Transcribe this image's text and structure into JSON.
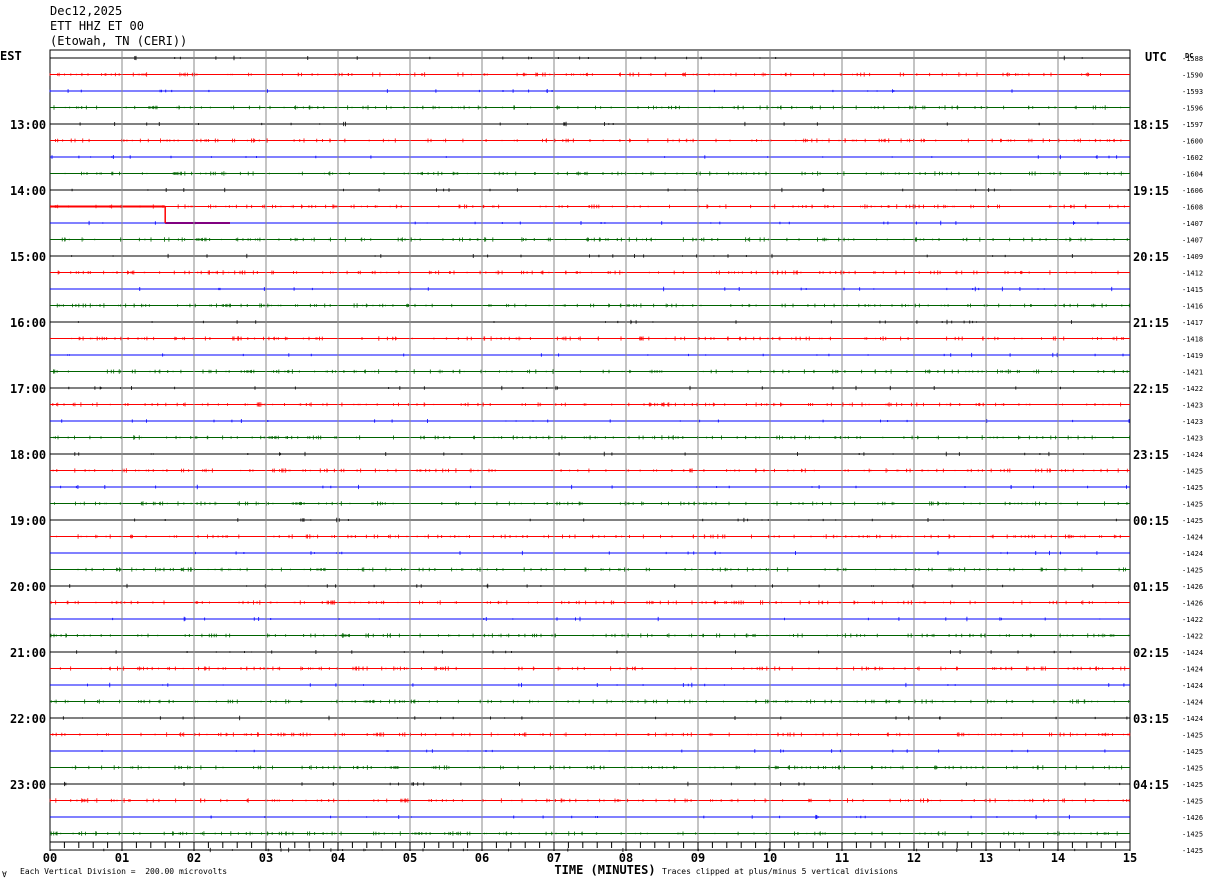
{
  "header": {
    "date": "Dec12,2025",
    "station": "ETT HHZ ET 00",
    "location": "(Etowah, TN (CERI))"
  },
  "footer": {
    "mark": "∀",
    "scale": "Each Vertical Division =  200.00 microvolts",
    "clip": "Traces clipped at plus/minus 5 vertical divisions"
  },
  "chart_data": {
    "type": "line",
    "title": "",
    "xlabel": "TIME (MINUTES)",
    "ylabel_left": "EST",
    "ylabel_right": "UTC",
    "dc_label": "DC",
    "xlim": [
      0,
      15
    ],
    "x_ticks": [
      "00",
      "01",
      "02",
      "03",
      "04",
      "05",
      "06",
      "07",
      "08",
      "09",
      "10",
      "11",
      "12",
      "13",
      "14",
      "15"
    ],
    "grid": true,
    "left_hour_labels": [
      "13:00",
      "14:00",
      "15:00",
      "16:00",
      "17:00",
      "18:00",
      "19:00",
      "20:00",
      "21:00",
      "22:00",
      "23:00"
    ],
    "right_hour_labels": [
      "18:15",
      "19:15",
      "20:15",
      "21:15",
      "22:15",
      "23:15",
      "00:15",
      "01:15",
      "02:15",
      "03:15",
      "04:15"
    ],
    "dc_offsets": [
      "-1588",
      "-1590",
      "-1593",
      "-1596",
      "-1597",
      "-1600",
      "-1602",
      "-1604",
      "-1606",
      "-1608",
      "-1407",
      "-1407",
      "-1409",
      "-1412",
      "-1415",
      "-1416",
      "-1417",
      "-1418",
      "-1419",
      "-1421",
      "-1422",
      "-1423",
      "-1423",
      "-1423",
      "-1424",
      "-1425",
      "-1425",
      "-1425",
      "-1425",
      "-1424",
      "-1424",
      "-1425",
      "-1426",
      "-1426",
      "-1422",
      "-1422",
      "-1424",
      "-1424",
      "-1424",
      "-1424",
      "-1424",
      "-1425",
      "-1425",
      "-1425",
      "-1425",
      "-1425",
      "-1426",
      "-1425",
      "-1425"
    ],
    "series": [
      {
        "color": "#000000",
        "trace_rows": [
          0,
          4,
          8,
          12,
          16,
          20,
          24,
          28,
          32,
          36,
          40,
          44,
          48
        ]
      },
      {
        "color": "#ff0000",
        "trace_rows": [
          1,
          5,
          9,
          13,
          17,
          21,
          25,
          29,
          33,
          37,
          41,
          45
        ]
      },
      {
        "color": "#0000ff",
        "trace_rows": [
          2,
          6,
          10,
          14,
          18,
          22,
          26,
          30,
          34,
          38,
          42,
          46
        ]
      },
      {
        "color": "#006400",
        "trace_rows": [
          3,
          7,
          11,
          15,
          19,
          23,
          27,
          31,
          35,
          39,
          43,
          47
        ]
      }
    ],
    "events": [
      {
        "row": 9,
        "from_minute": 0.0,
        "to_minute": 1.6,
        "note": "offset step"
      },
      {
        "row": 10,
        "from_minute": 1.6,
        "to_minute": 2.5,
        "note": "offset step"
      }
    ]
  }
}
